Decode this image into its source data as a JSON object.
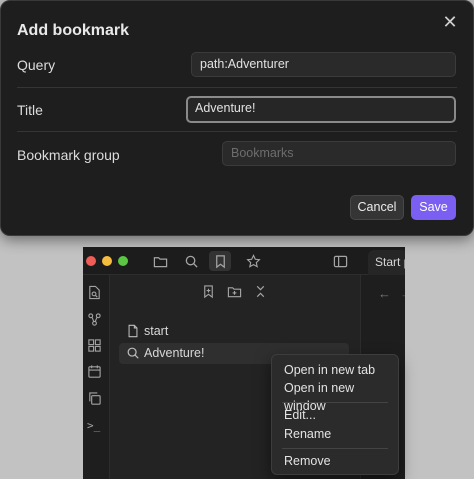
{
  "modal": {
    "title": "Add bookmark",
    "close_glyph": "✕",
    "query": {
      "label": "Query",
      "value": "path:Adventurer"
    },
    "title_field": {
      "label": "Title",
      "value": "Adventure!"
    },
    "group": {
      "label": "Bookmark group",
      "placeholder": "Bookmarks"
    },
    "cancel_label": "Cancel",
    "save_label": "Save",
    "colors": {
      "accent": "#7b5ff2",
      "background": "#1e1e1e"
    }
  },
  "app": {
    "tab_label": "Start p",
    "toolbar_icons": [
      "folder-icon",
      "search-icon",
      "bookmark-icon",
      "star-icon",
      "sidebar-toggle-icon"
    ],
    "rail_icons": [
      "file-search-icon",
      "graph-icon",
      "grid-icon",
      "calendar-icon",
      "copy-icon",
      "terminal-icon"
    ],
    "terminal_glyph": ">_",
    "sidebar_tools": [
      "add-bookmark-icon",
      "new-group-icon",
      "collapse-icon"
    ],
    "bookmarks": [
      {
        "label": "start",
        "icon": "file-icon"
      },
      {
        "label": "Adventure!",
        "icon": "search-icon"
      }
    ],
    "back_glyph": "←",
    "forward_glyph": "→"
  },
  "context_menu": {
    "items": [
      "Open in new tab",
      "Open in new window",
      "Edit...",
      "Rename",
      "Remove"
    ]
  }
}
